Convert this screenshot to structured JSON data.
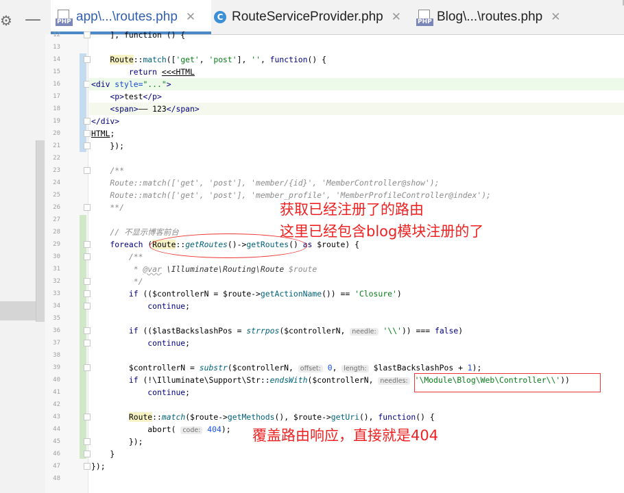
{
  "tabs": [
    {
      "label": "app\\...\\routes.php",
      "icon": "php-file-icon",
      "active": true
    },
    {
      "label": "RouteServiceProvider.php",
      "icon": "class-c-icon",
      "active": false
    },
    {
      "label": "Blog\\...\\routes.php",
      "icon": "php-file-icon",
      "active": false
    }
  ],
  "icons": {
    "settings": "gear-icon",
    "hide": "minus-icon",
    "close": "close-icon"
  },
  "line_numbers": [
    "12",
    "13",
    "14",
    "15",
    "16",
    "17",
    "18",
    "19",
    "20",
    "21",
    "22",
    "23",
    "24",
    "25",
    "26",
    "27",
    "28",
    "29",
    "30",
    "31",
    "32",
    "33",
    "34",
    "35",
    "36",
    "37",
    "38",
    "39",
    "40",
    "41",
    "42",
    "43",
    "44",
    "45",
    "46",
    "47",
    "48"
  ],
  "annotations": {
    "note1_line1": "获取已经注册了的路由",
    "note1_line2": "这里已经包含blog模块注册的了",
    "note2": "覆盖路由响应，直接就是404"
  },
  "colors": {
    "annotation": "#ee2222",
    "active_tab_underline": "#4a88c7"
  }
}
